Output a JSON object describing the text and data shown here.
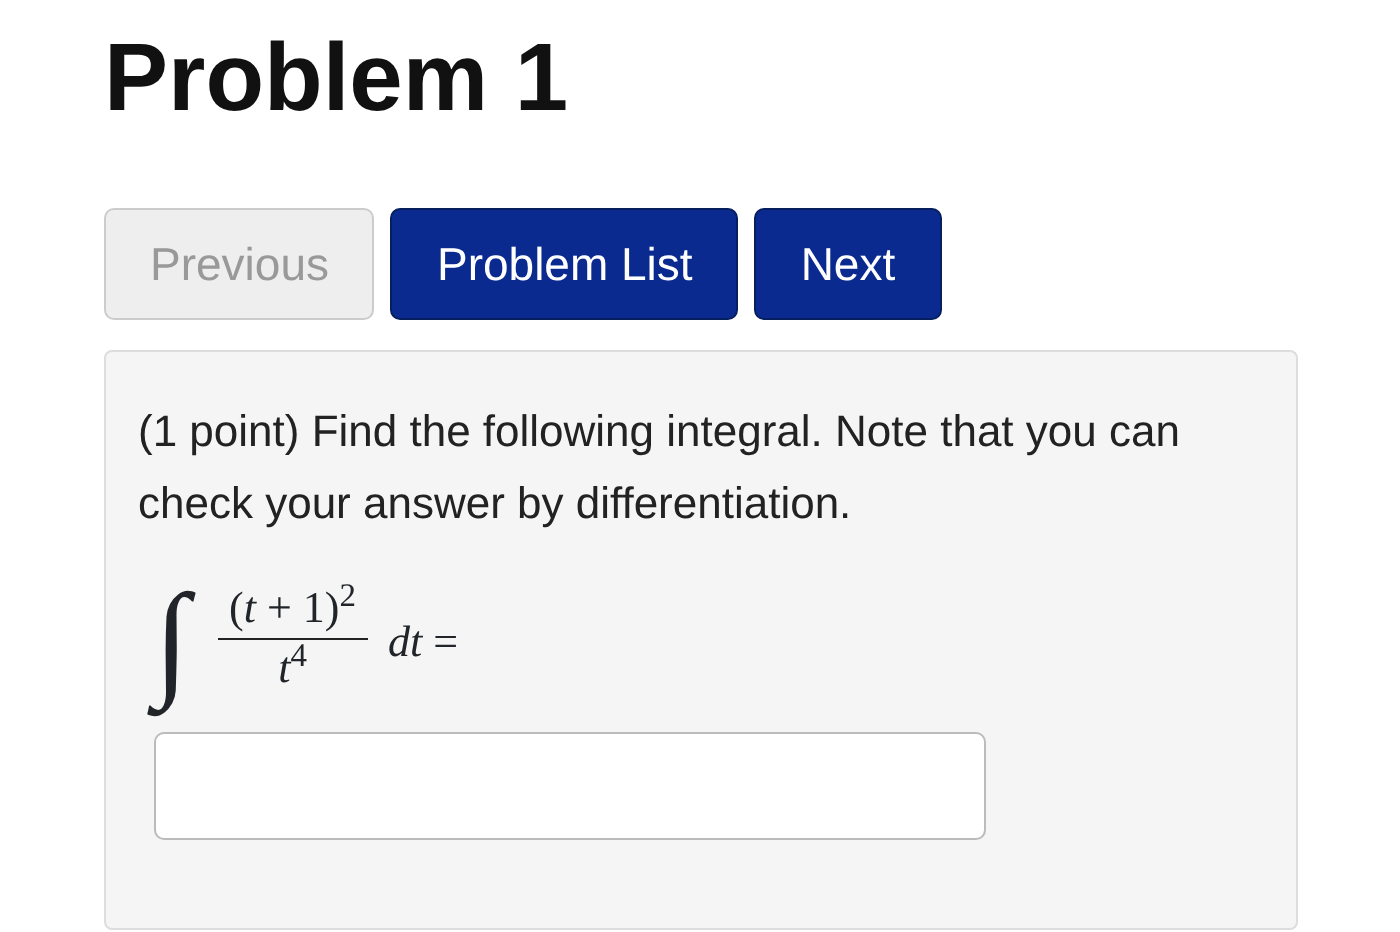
{
  "title": "Problem 1",
  "nav_buttons": [
    {
      "label": "Previous",
      "disabled": true
    },
    {
      "label": "Problem List",
      "disabled": false
    },
    {
      "label": "Next",
      "disabled": false
    }
  ],
  "problem": {
    "text": "(1 point) Find the following integral. Note that you can check your answer by differentiation.",
    "formula": {
      "integral_sign": "∫",
      "numerator": "(*t* + 1)$^{2}$",
      "denominator": "*t*$^{4}$",
      "suffix": "*dt* ="
    }
  }
}
